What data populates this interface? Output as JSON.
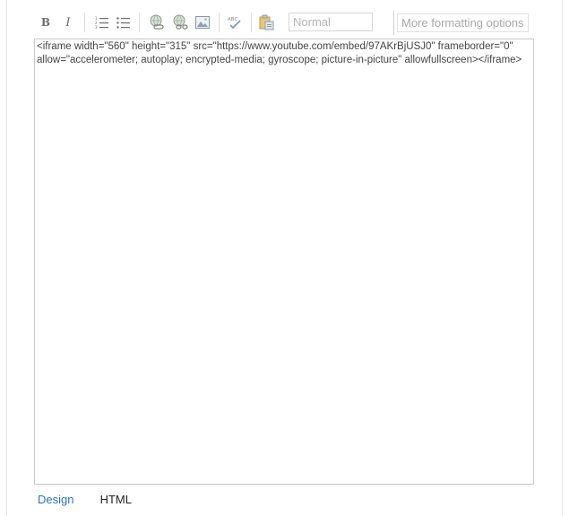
{
  "toolbar": {
    "buttons": [
      {
        "name": "bold",
        "glyph": "B",
        "icon": "bold-icon"
      },
      {
        "name": "italic",
        "glyph": "I",
        "icon": "italic-icon"
      },
      {
        "name": "ordered-list",
        "icon": "ordered-list-icon"
      },
      {
        "name": "bullet-list",
        "icon": "bullet-list-icon"
      },
      {
        "name": "insert-link",
        "icon": "link-icon"
      },
      {
        "name": "remove-link",
        "icon": "unlink-icon"
      },
      {
        "name": "insert-image",
        "icon": "image-icon"
      },
      {
        "name": "spell-check",
        "icon": "spell-check-icon"
      },
      {
        "name": "paste",
        "icon": "paste-icon"
      }
    ],
    "style_select_value": "Normal",
    "more_formatting_label": "More formatting options"
  },
  "editor": {
    "content": "<iframe width=\"560\" height=\"315\" src=\"https://www.youtube.com/embed/97AKrBjUSJ0\" frameborder=\"0\" allow=\"accelerometer; autoplay; encrypted-media; gyroscope; picture-in-picture\" allowfullscreen></iframe>"
  },
  "mode_tabs": [
    {
      "label": "Design",
      "active": true
    },
    {
      "label": "HTML",
      "active": false
    }
  ],
  "colors": {
    "active_tab": "#2d74c2",
    "icon_gray": "#6d6d6d",
    "border": "#c8c8c8"
  }
}
